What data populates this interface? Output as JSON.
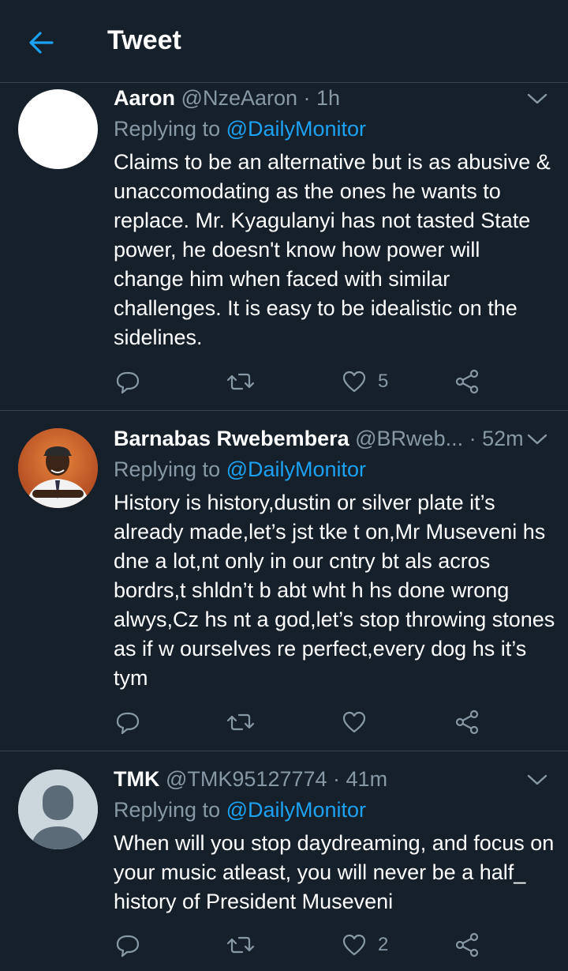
{
  "header": {
    "title": "Tweet",
    "back_icon": "arrow-left-icon"
  },
  "colors": {
    "background": "#15202b",
    "accent": "#1da1f2",
    "muted": "#8899a6",
    "divider": "#38444d"
  },
  "tweets": [
    {
      "name": "Aaron",
      "handle": "@NzeAaron",
      "time": "· 1h",
      "replying_prefix": "Replying to ",
      "replying_to": "@DailyMonitor",
      "text": "Claims to be an alternative but is as abusive & unaccomodating as the ones he wants to replace. Mr. Kyagulanyi has not tasted State power, he doesn't know how power will change him when faced with similar challenges. It is easy to be idealistic on the sidelines.",
      "likes": "5"
    },
    {
      "name": "Barnabas Rwebembera",
      "handle": "@BRweb...",
      "time": "· 52m",
      "replying_prefix": "Replying to ",
      "replying_to": "@DailyMonitor",
      "text": "History is history,dustin or silver plate it’s already made,let’s jst tke t on,Mr Museveni hs dne a lot,nt only in our cntry bt als acros bordrs,t shldn’t b abt wht h hs done wrong alwys,Cz hs nt a god,let’s stop throwing stones as if w ourselves re perfect,every dog hs it’s tym",
      "likes": ""
    },
    {
      "name": "TMK",
      "handle": "@TMK95127774",
      "time": "· 41m",
      "replying_prefix": "Replying to ",
      "replying_to": "@DailyMonitor",
      "text": "When will you stop daydreaming, and focus on your music atleast, you will never be a half_ history of President Museveni",
      "likes": "2"
    }
  ]
}
